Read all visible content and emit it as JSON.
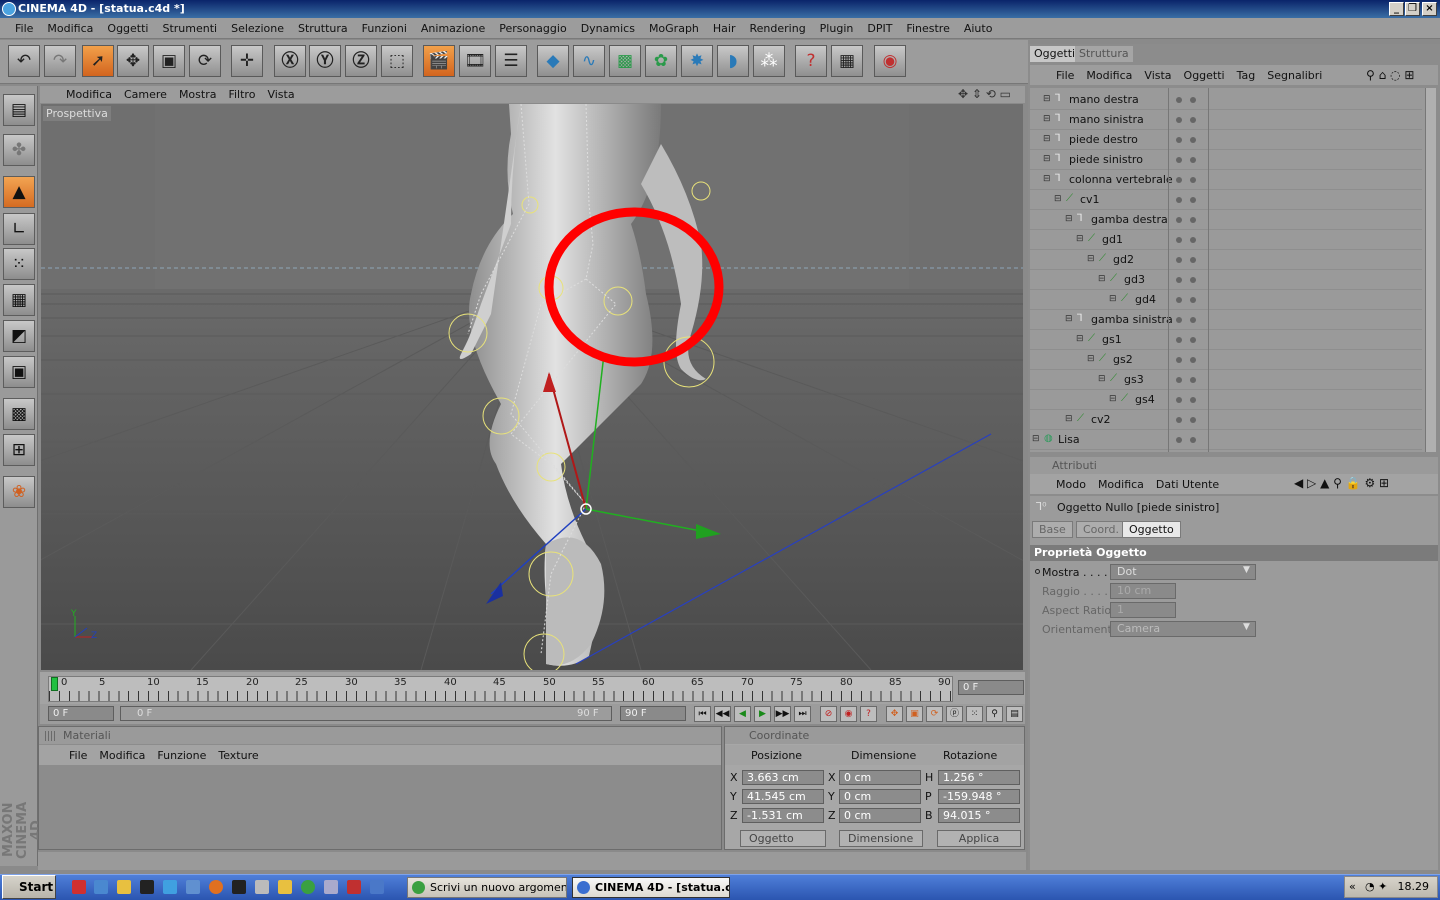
{
  "window": {
    "title": "CINEMA 4D - [statua.c4d *]"
  },
  "menu": [
    "File",
    "Modifica",
    "Oggetti",
    "Strumenti",
    "Selezione",
    "Struttura",
    "Funzioni",
    "Animazione",
    "Personaggio",
    "Dynamics",
    "MoGraph",
    "Hair",
    "Rendering",
    "Plugin",
    "DPIT",
    "Finestre",
    "Aiuto"
  ],
  "viewport": {
    "menu": [
      "Modifica",
      "Camere",
      "Mostra",
      "Filtro",
      "Vista"
    ],
    "label": "Prospettiva"
  },
  "timeline": {
    "ticks": [
      "0",
      "5",
      "10",
      "15",
      "20",
      "25",
      "30",
      "35",
      "40",
      "45",
      "50",
      "55",
      "60",
      "65",
      "70",
      "75",
      "80",
      "85",
      "90"
    ],
    "current_frame": "0 F",
    "start_field": "0 F",
    "range_start": "0 F",
    "range_end": "90 F",
    "end_field": "90 F"
  },
  "materials": {
    "title": "Materiali",
    "menu": [
      "File",
      "Modifica",
      "Funzione",
      "Texture"
    ]
  },
  "coords": {
    "title": "Coordinate",
    "col_position": "Posizione",
    "col_dimension": "Dimensione",
    "col_rotation": "Rotazione",
    "axes": [
      "X",
      "Y",
      "Z"
    ],
    "rot_axes": [
      "H",
      "P",
      "B"
    ],
    "position": [
      "3.663 cm",
      "41.545 cm",
      "-1.531 cm"
    ],
    "dimension": [
      "0 cm",
      "0 cm",
      "0 cm"
    ],
    "rotation": [
      "1.256 °",
      "-159.948 °",
      "94.015 °"
    ],
    "mode_select": "Oggetto",
    "dim_select": "Dimensione",
    "apply": "Applica"
  },
  "objects": {
    "tabs": [
      "Oggetti",
      "Struttura"
    ],
    "menu": [
      "File",
      "Modifica",
      "Vista",
      "Oggetti",
      "Tag",
      "Segnalibri"
    ],
    "items": [
      {
        "name": "mano destra",
        "level": 1,
        "type": "null"
      },
      {
        "name": "mano sinistra",
        "level": 1,
        "type": "null"
      },
      {
        "name": "piede destro",
        "level": 1,
        "type": "null"
      },
      {
        "name": "piede sinistro",
        "level": 1,
        "type": "null"
      },
      {
        "name": "colonna vertebrale",
        "level": 1,
        "type": "null"
      },
      {
        "name": "cv1",
        "level": 2,
        "type": "joint"
      },
      {
        "name": "gamba destra",
        "level": 3,
        "type": "null"
      },
      {
        "name": "gd1",
        "level": 4,
        "type": "joint"
      },
      {
        "name": "gd2",
        "level": 5,
        "type": "joint"
      },
      {
        "name": "gd3",
        "level": 6,
        "type": "joint"
      },
      {
        "name": "gd4",
        "level": 7,
        "type": "joint"
      },
      {
        "name": "gamba sinistra",
        "level": 3,
        "type": "null"
      },
      {
        "name": "gs1",
        "level": 4,
        "type": "joint"
      },
      {
        "name": "gs2",
        "level": 5,
        "type": "joint"
      },
      {
        "name": "gs3",
        "level": 6,
        "type": "joint"
      },
      {
        "name": "gs4",
        "level": 7,
        "type": "joint"
      },
      {
        "name": "cv2",
        "level": 3,
        "type": "joint"
      },
      {
        "name": "Lisa",
        "level": 0,
        "type": "mesh"
      }
    ]
  },
  "attributes": {
    "title": "Attributi",
    "menu": [
      "Modo",
      "Modifica",
      "Dati Utente"
    ],
    "object_title": "Oggetto Nullo [piede sinistro]",
    "tabs": [
      "Base",
      "Coord.",
      "Oggetto"
    ],
    "section": "Proprietà Oggetto",
    "props": [
      {
        "label": "Mostra . . . . .",
        "value": "Dot"
      },
      {
        "label": "Raggio . . . .",
        "value": "10 cm"
      },
      {
        "label": "Aspect Ratio",
        "value": "1"
      },
      {
        "label": "Orientamento",
        "value": "Camera"
      }
    ]
  },
  "brand": "MAXON CINEMA 4D",
  "taskbar": {
    "start": "Start",
    "tasks": [
      "Scrivi un nuovo argomen...",
      "CINEMA 4D - [statua.c..."
    ],
    "clock": "18.29"
  },
  "colors": {
    "accent": "#d8702a",
    "axis_x": "#c02020",
    "axis_y": "#20b020",
    "axis_z": "#2040c0",
    "annotation": "#ff0000"
  }
}
